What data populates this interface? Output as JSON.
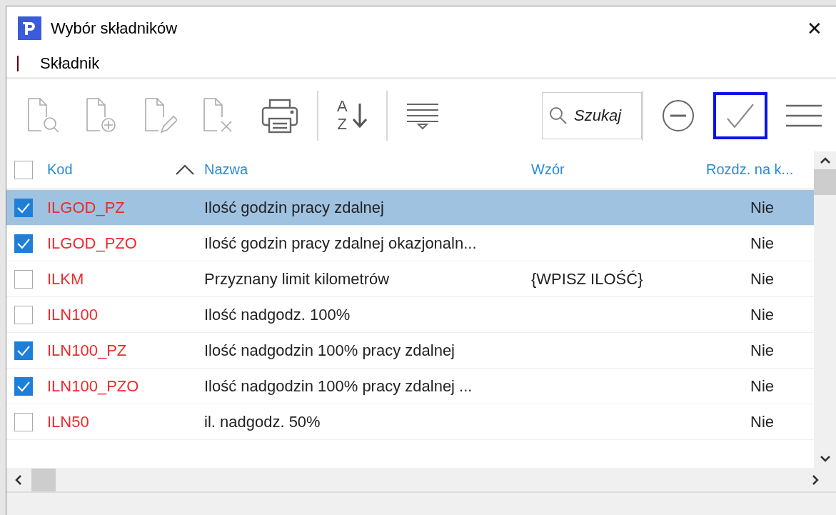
{
  "window": {
    "title": "Wybór składników",
    "close": "✕"
  },
  "menu": [
    {
      "label": "Składnik"
    }
  ],
  "toolbar": {
    "buttons": [
      {
        "kind": "preview",
        "disabled": true
      },
      {
        "kind": "add",
        "disabled": true
      },
      {
        "kind": "edit",
        "disabled": true
      },
      {
        "kind": "delete",
        "disabled": true
      },
      {
        "kind": "print",
        "disabled": false
      },
      {
        "kind": "separator"
      },
      {
        "kind": "sort",
        "label_top": "A",
        "label_bottom": "Z"
      },
      {
        "kind": "separator"
      },
      {
        "kind": "filter"
      },
      {
        "kind": "spacer"
      },
      {
        "kind": "search",
        "placeholder": "Szukaj"
      },
      {
        "kind": "separator"
      },
      {
        "kind": "cancel"
      },
      {
        "kind": "ok",
        "focused": true
      },
      {
        "kind": "menu"
      }
    ]
  },
  "table": {
    "all_checked": false,
    "columns": [
      {
        "label": "Kod",
        "sorted": true
      },
      {
        "label": "Nazwa",
        "sorted": false
      },
      {
        "label": "Wzór",
        "sorted": false
      },
      {
        "label": "Rozdz. na k...",
        "sorted": false
      }
    ],
    "rows": [
      {
        "checked": true,
        "selected": true,
        "cells": [
          "ILGOD_PZ",
          "Ilość godzin pracy zdalnej",
          "",
          "Nie"
        ]
      },
      {
        "checked": true,
        "selected": false,
        "cells": [
          "ILGOD_PZO",
          "Ilość godzin pracy zdalnej okazjonaln...",
          "",
          "Nie"
        ]
      },
      {
        "checked": false,
        "selected": false,
        "cells": [
          "ILKM",
          "Przyznany limit kilometrów",
          "{WPISZ ILOŚĆ}",
          "Nie"
        ]
      },
      {
        "checked": false,
        "selected": false,
        "cells": [
          "ILN100",
          "Ilość nadgodz. 100%",
          "",
          "Nie"
        ]
      },
      {
        "checked": true,
        "selected": false,
        "cells": [
          "ILN100_PZ",
          "Ilość nadgodzin 100% pracy zdalnej",
          "",
          "Nie"
        ]
      },
      {
        "checked": true,
        "selected": false,
        "cells": [
          "ILN100_PZO",
          "Ilość nadgodzin 100% pracy zdalnej ...",
          "",
          "Nie"
        ]
      },
      {
        "checked": false,
        "selected": false,
        "cells": [
          "ILN50",
          "il. nadgodz. 50%",
          "",
          "Nie"
        ]
      }
    ]
  }
}
